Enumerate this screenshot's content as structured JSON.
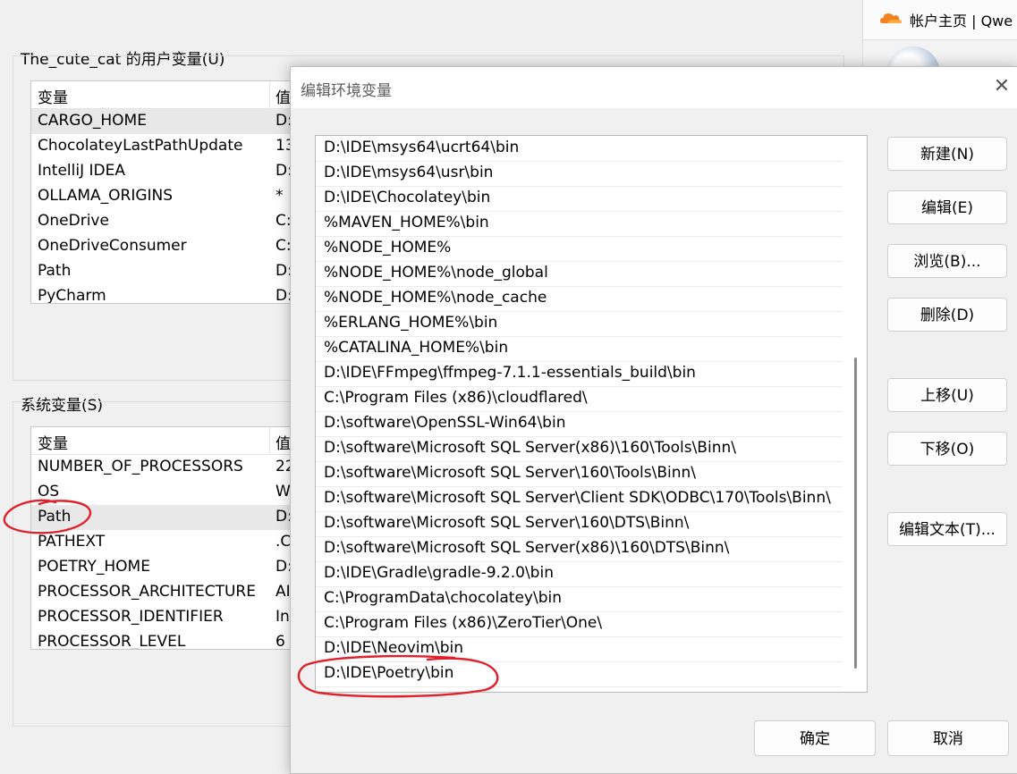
{
  "user_vars": {
    "group_title": "The_cute_cat 的用户变量(U)",
    "col_name": "变量",
    "col_value": "值",
    "rows": [
      {
        "name": "CARGO_HOME",
        "value": "D:"
      },
      {
        "name": "ChocolateyLastPathUpdate",
        "value": "13"
      },
      {
        "name": "IntelliJ IDEA",
        "value": "D:"
      },
      {
        "name": "OLLAMA_ORIGINS",
        "value": "*"
      },
      {
        "name": "OneDrive",
        "value": "C:"
      },
      {
        "name": "OneDriveConsumer",
        "value": "C:"
      },
      {
        "name": "Path",
        "value": "D:"
      },
      {
        "name": "PyCharm",
        "value": "D:"
      }
    ]
  },
  "system_vars": {
    "group_title": "系统变量(S)",
    "col_name": "变量",
    "col_value": "值",
    "rows": [
      {
        "name": "NUMBER_OF_PROCESSORS",
        "value": "22"
      },
      {
        "name": "OS",
        "value": "W"
      },
      {
        "name": "Path",
        "value": "D:"
      },
      {
        "name": "PATHEXT",
        "value": ".C"
      },
      {
        "name": "POETRY_HOME",
        "value": "D:"
      },
      {
        "name": "PROCESSOR_ARCHITECTURE",
        "value": "AI"
      },
      {
        "name": "PROCESSOR_IDENTIFIER",
        "value": "In"
      },
      {
        "name": "PROCESSOR_LEVEL",
        "value": "6"
      }
    ]
  },
  "browser": {
    "tab_title": "帐户主页 | Qwe",
    "icon": "cloudflare-icon"
  },
  "dialog": {
    "title": "编辑环境变量",
    "close_icon": "close-icon",
    "path_entries": [
      "D:\\IDE\\msys64\\ucrt64\\bin",
      "D:\\IDE\\msys64\\usr\\bin",
      "D:\\IDE\\Chocolatey\\bin",
      "%MAVEN_HOME%\\bin",
      "%NODE_HOME%",
      "%NODE_HOME%\\node_global",
      "%NODE_HOME%\\node_cache",
      "%ERLANG_HOME%\\bin",
      "%CATALINA_HOME%\\bin",
      "D:\\IDE\\FFmpeg\\ffmpeg-7.1.1-essentials_build\\bin",
      "C:\\Program Files (x86)\\cloudflared\\",
      "D:\\software\\OpenSSL-Win64\\bin",
      "D:\\software\\Microsoft SQL Server(x86)\\160\\Tools\\Binn\\",
      "D:\\software\\Microsoft SQL Server\\160\\Tools\\Binn\\",
      "D:\\software\\Microsoft SQL Server\\Client SDK\\ODBC\\170\\Tools\\Binn\\",
      "D:\\software\\Microsoft SQL Server\\160\\DTS\\Binn\\",
      "D:\\software\\Microsoft SQL Server(x86)\\160\\DTS\\Binn\\",
      "D:\\IDE\\Gradle\\gradle-9.2.0\\bin",
      "C:\\ProgramData\\chocolatey\\bin",
      "C:\\Program Files (x86)\\ZeroTier\\One\\",
      "D:\\IDE\\Neovim\\bin",
      "D:\\IDE\\Poetry\\bin"
    ],
    "buttons": {
      "new": "新建(N)",
      "edit": "编辑(E)",
      "browse": "浏览(B)...",
      "delete": "删除(D)",
      "move_up": "上移(U)",
      "move_down": "下移(O)",
      "edit_text": "编辑文本(T)...",
      "ok": "确定",
      "cancel": "取消"
    }
  },
  "annotations": {
    "color": "#e0202a"
  }
}
